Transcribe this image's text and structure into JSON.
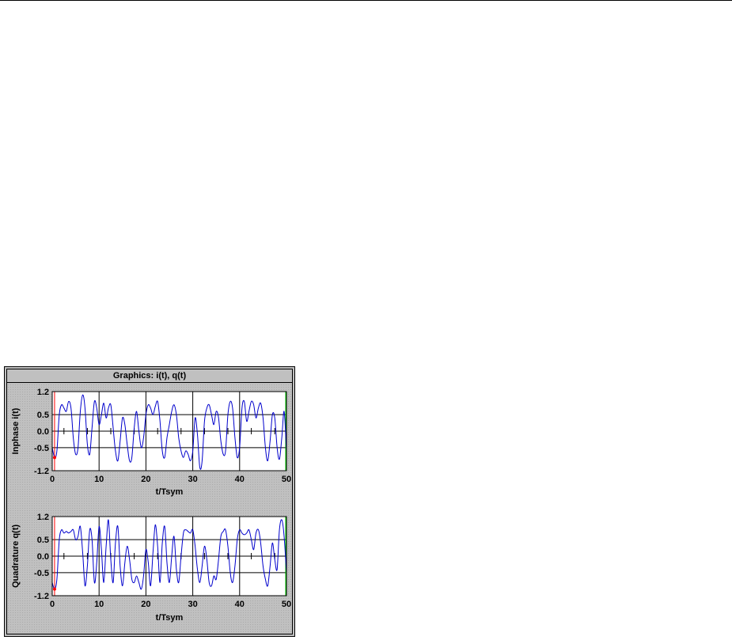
{
  "panel": {
    "title": "Graphics: i(t), q(t)"
  },
  "chart_data": [
    {
      "type": "line",
      "ylabel": "Inphase i(t)",
      "xlabel": "t/Tsym",
      "xlim": [
        0,
        50
      ],
      "ylim": [
        -1.2,
        1.2
      ],
      "xticks": [
        0,
        10,
        20,
        30,
        40,
        50
      ],
      "xtick_labels": [
        "0",
        "10",
        "20",
        "30",
        "40",
        "50"
      ],
      "yticks": [
        1.2,
        0.5,
        0.0,
        -0.5,
        -1.2
      ],
      "ytick_labels": [
        "1.2",
        "0.5",
        "0.0",
        "-0.5",
        "-1.2"
      ],
      "grid": true,
      "colors": {
        "series": "#0000cc",
        "start_marker": "#ff0000",
        "end_marker": "#00cc00"
      },
      "series": [
        {
          "x": [
            0.0,
            0.5,
            1.0,
            1.5,
            2.0,
            2.5,
            3.0,
            3.5,
            4.0,
            4.5,
            5.0,
            5.5,
            6.0,
            6.5,
            7.0,
            7.5,
            8.0,
            8.5,
            9.0,
            9.5,
            10.0,
            10.5,
            11.0,
            11.5,
            12.0,
            12.5,
            13.0,
            13.5,
            14.0,
            14.5,
            15.0,
            15.5,
            16.0,
            16.5,
            17.0,
            17.5,
            18.0,
            18.5,
            19.0,
            19.5,
            20.0,
            20.5,
            21.0,
            21.5,
            22.0,
            22.5,
            23.0,
            23.5,
            24.0,
            24.5,
            25.0,
            25.5,
            26.0,
            26.5,
            27.0,
            27.5,
            28.0,
            28.5,
            29.0,
            29.5,
            30.0,
            30.5,
            31.0,
            31.5,
            32.0,
            32.5,
            33.0,
            33.5,
            34.0,
            34.5,
            35.0,
            35.5,
            36.0,
            36.5,
            37.0,
            37.5,
            38.0,
            38.5,
            39.0,
            39.5,
            40.0,
            40.5,
            41.0,
            41.5,
            42.0,
            42.5,
            43.0,
            43.5,
            44.0,
            44.5,
            45.0,
            45.5,
            46.0,
            46.5,
            47.0,
            47.5,
            48.0,
            48.5,
            49.0,
            49.5,
            50.0
          ],
          "y": [
            -0.5,
            -0.8,
            -0.6,
            0.5,
            0.8,
            0.7,
            0.6,
            0.9,
            0.7,
            -0.2,
            -0.7,
            -0.5,
            0.6,
            1.1,
            0.7,
            -0.4,
            -0.7,
            0.1,
            0.9,
            0.7,
            0.2,
            0.5,
            0.85,
            0.4,
            0.7,
            0.8,
            0.1,
            -0.6,
            -0.9,
            -0.3,
            0.4,
            0.2,
            -0.4,
            -0.9,
            -0.8,
            0.1,
            0.6,
            0.0,
            -0.5,
            -0.2,
            0.5,
            0.8,
            0.7,
            0.5,
            0.75,
            0.9,
            0.3,
            -0.6,
            -0.8,
            -0.2,
            0.2,
            0.6,
            0.8,
            0.5,
            -0.2,
            -0.6,
            -0.8,
            -0.6,
            -0.7,
            -0.9,
            -0.6,
            0.4,
            -0.1,
            -1.1,
            -0.9,
            0.3,
            0.7,
            0.8,
            0.5,
            0.2,
            0.6,
            0.4,
            -0.3,
            -0.7,
            -0.6,
            0.5,
            0.9,
            0.7,
            -0.2,
            -0.8,
            -0.5,
            0.7,
            0.9,
            0.3,
            0.6,
            0.9,
            0.8,
            0.4,
            0.7,
            0.85,
            0.4,
            -0.5,
            -0.9,
            -0.3,
            0.5,
            0.4,
            -0.5,
            -0.85,
            -0.2,
            0.6,
            -0.6
          ]
        }
      ]
    },
    {
      "type": "line",
      "ylabel": "Quadrature q(t)",
      "xlabel": "t/Tsym",
      "xlim": [
        0,
        50
      ],
      "ylim": [
        -1.2,
        1.2
      ],
      "xticks": [
        0,
        10,
        20,
        30,
        40,
        50
      ],
      "xtick_labels": [
        "0",
        "10",
        "20",
        "30",
        "40",
        "50"
      ],
      "yticks": [
        1.2,
        0.5,
        0.0,
        -0.5,
        -1.2
      ],
      "ytick_labels": [
        "1.2",
        "0.5",
        "0.0",
        "-0.5",
        "-1.2"
      ],
      "grid": true,
      "colors": {
        "series": "#0000cc",
        "start_marker": "#ff0000",
        "end_marker": "#00cc00"
      },
      "series": [
        {
          "x": [
            0.0,
            0.5,
            1.0,
            1.5,
            2.0,
            2.5,
            3.0,
            3.5,
            4.0,
            4.5,
            5.0,
            5.5,
            6.0,
            6.5,
            7.0,
            7.5,
            8.0,
            8.5,
            9.0,
            9.5,
            10.0,
            10.5,
            11.0,
            11.5,
            12.0,
            12.5,
            13.0,
            13.5,
            14.0,
            14.5,
            15.0,
            15.5,
            16.0,
            16.5,
            17.0,
            17.5,
            18.0,
            18.5,
            19.0,
            19.5,
            20.0,
            20.5,
            21.0,
            21.5,
            22.0,
            22.5,
            23.0,
            23.5,
            24.0,
            24.5,
            25.0,
            25.5,
            26.0,
            26.5,
            27.0,
            27.5,
            28.0,
            28.5,
            29.0,
            29.5,
            30.0,
            30.5,
            31.0,
            31.5,
            32.0,
            32.5,
            33.0,
            33.5,
            34.0,
            34.5,
            35.0,
            35.5,
            36.0,
            36.5,
            37.0,
            37.5,
            38.0,
            38.5,
            39.0,
            39.5,
            40.0,
            40.5,
            41.0,
            41.5,
            42.0,
            42.5,
            43.0,
            43.5,
            44.0,
            44.5,
            45.0,
            45.5,
            46.0,
            46.5,
            47.0,
            47.5,
            48.0,
            48.5,
            49.0,
            49.5,
            50.0
          ],
          "y": [
            -0.8,
            -1.0,
            -0.7,
            0.5,
            0.8,
            0.7,
            0.75,
            0.7,
            0.75,
            0.8,
            0.5,
            0.6,
            0.9,
            0.1,
            -0.9,
            -0.3,
            0.8,
            0.5,
            -0.8,
            -0.2,
            0.9,
            0.2,
            -0.8,
            0.3,
            1.1,
            -0.1,
            -0.8,
            0.4,
            0.9,
            -0.3,
            -0.9,
            -0.2,
            0.3,
            -0.1,
            -0.7,
            -0.8,
            -0.6,
            -0.8,
            -1.0,
            -0.6,
            0.2,
            -0.2,
            -0.9,
            0.1,
            0.95,
            0.3,
            -0.8,
            0.4,
            0.9,
            -0.2,
            -0.8,
            0.0,
            0.6,
            -0.4,
            -0.8,
            0.0,
            0.7,
            0.8,
            0.75,
            0.7,
            0.8,
            0.3,
            -0.4,
            -0.8,
            -0.3,
            0.3,
            -0.1,
            -0.8,
            -0.9,
            -0.6,
            -0.7,
            -0.1,
            0.6,
            0.75,
            0.8,
            0.3,
            -0.5,
            -0.8,
            -0.3,
            0.5,
            0.8,
            0.7,
            0.65,
            0.7,
            0.8,
            0.5,
            0.2,
            0.7,
            0.8,
            0.4,
            -0.3,
            -0.7,
            -0.9,
            -0.3,
            0.4,
            -0.1,
            -0.4,
            0.8,
            1.1,
            0.6,
            -0.5
          ]
        }
      ]
    }
  ]
}
